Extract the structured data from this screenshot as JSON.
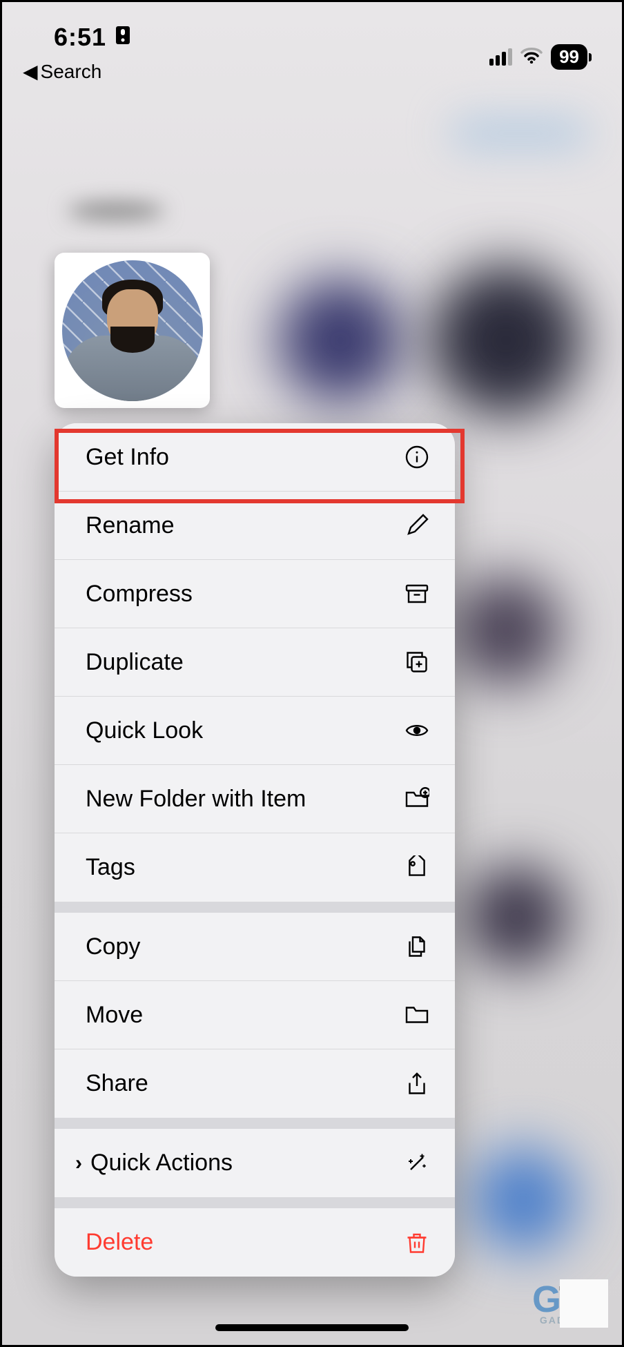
{
  "status_bar": {
    "time": "6:51",
    "breadcrumb": "Search",
    "battery": "99"
  },
  "menu": {
    "group1": [
      {
        "label": "Get Info",
        "icon": "info-circle"
      },
      {
        "label": "Rename",
        "icon": "pencil"
      },
      {
        "label": "Compress",
        "icon": "archivebox"
      },
      {
        "label": "Duplicate",
        "icon": "duplicate"
      },
      {
        "label": "Quick Look",
        "icon": "eye"
      },
      {
        "label": "New Folder with Item",
        "icon": "folder-plus"
      },
      {
        "label": "Tags",
        "icon": "tag"
      }
    ],
    "group2": [
      {
        "label": "Copy",
        "icon": "doc-on-doc"
      },
      {
        "label": "Move",
        "icon": "folder"
      },
      {
        "label": "Share",
        "icon": "share-up"
      }
    ],
    "group3": [
      {
        "label": "Quick Actions",
        "icon": "wand"
      }
    ],
    "group4": [
      {
        "label": "Delete",
        "icon": "trash"
      }
    ]
  },
  "watermark": {
    "brand": "GADGETS"
  }
}
